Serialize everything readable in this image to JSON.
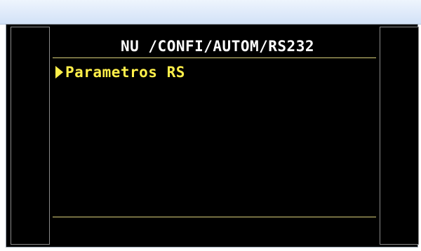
{
  "display": {
    "path": "NU /CONFI/AUTOM/RS232",
    "menu_items": [
      {
        "label": "Parametros RS",
        "selected": true
      }
    ]
  },
  "colors": {
    "background": "#000000",
    "title_text": "#ffffff",
    "selected_text": "#ffef4a",
    "rule": "#d9d07a"
  },
  "icons": {
    "cursor": "triangle-right-icon"
  }
}
